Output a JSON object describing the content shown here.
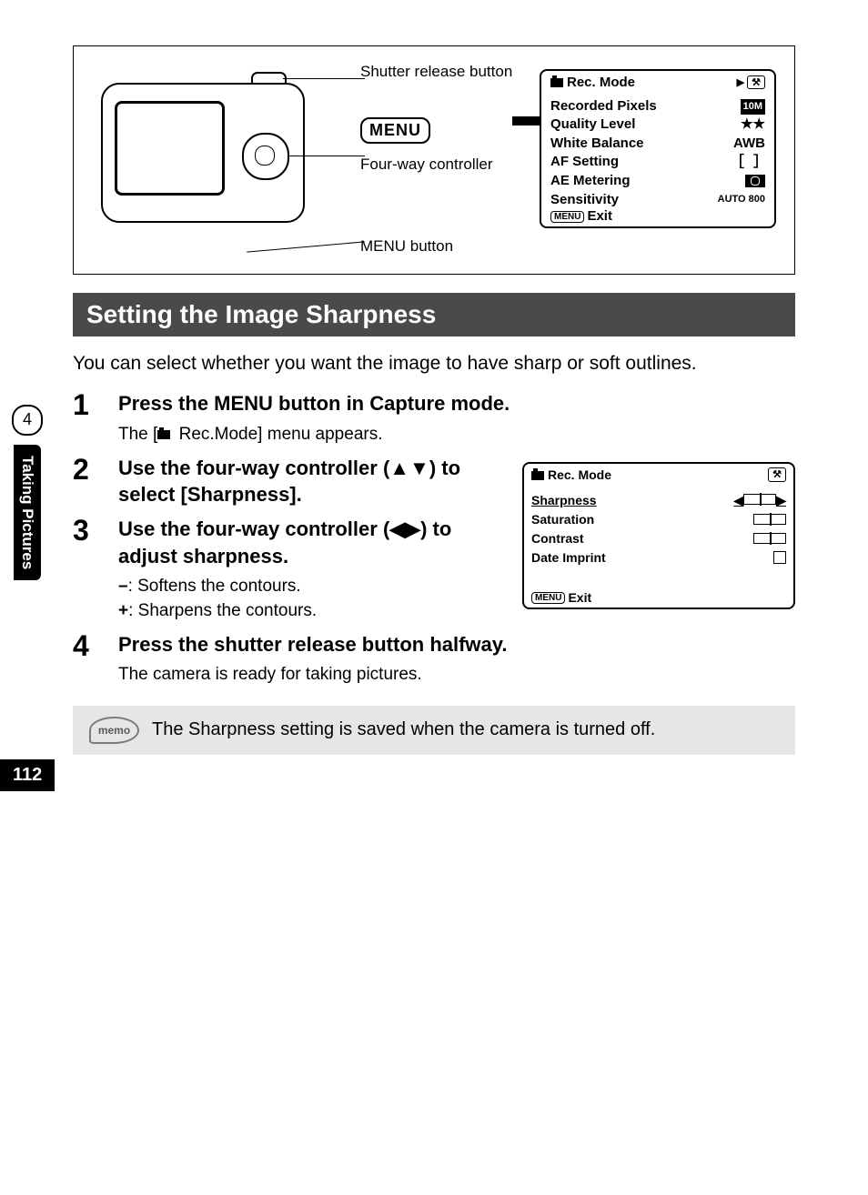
{
  "figure": {
    "labels": {
      "shutter": "Shutter release button",
      "fourway": "Four-way controller",
      "menubtn": "MENU button",
      "menuchip": "MENU"
    }
  },
  "lcd1": {
    "title": "Rec. Mode",
    "rows": [
      {
        "label": "Recorded Pixels",
        "value": "10M"
      },
      {
        "label": "Quality Level",
        "value": "★★"
      },
      {
        "label": "White Balance",
        "value": "AWB"
      },
      {
        "label": "AF Setting",
        "value": ""
      },
      {
        "label": "AE Metering",
        "value": ""
      },
      {
        "label": "Sensitivity",
        "value": "AUTO 800"
      }
    ],
    "exit": "Exit",
    "menuchip": "MENU"
  },
  "section_title": "Setting the Image Sharpness",
  "intro": "You can select whether you want the image to have sharp or soft outlines.",
  "steps": [
    {
      "num": "1",
      "title": "Press the MENU button in Capture mode.",
      "sub": "The [📷 Rec.Mode] menu appears."
    },
    {
      "num": "2",
      "title": "Use the four-way controller (▲▼) to select [Sharpness].",
      "sub": ""
    },
    {
      "num": "3",
      "title": "Use the four-way controller (◀▶) to adjust sharpness.",
      "sub": "–: Softens the contours.\n+: Sharpens the contours."
    },
    {
      "num": "4",
      "title": "Press the shutter release button halfway.",
      "sub": "The camera is ready for taking pictures."
    }
  ],
  "lcd2": {
    "title": "Rec. Mode",
    "rows": [
      {
        "label": "Sharpness",
        "selected": true
      },
      {
        "label": "Saturation"
      },
      {
        "label": "Contrast"
      },
      {
        "label": "Date Imprint"
      }
    ],
    "exit": "Exit",
    "menuchip": "MENU"
  },
  "memo": {
    "label": "memo",
    "text": "The Sharpness setting is saved when the camera is turned off."
  },
  "sidebar": {
    "num": "4",
    "label": "Taking Pictures"
  },
  "page_num": "112"
}
